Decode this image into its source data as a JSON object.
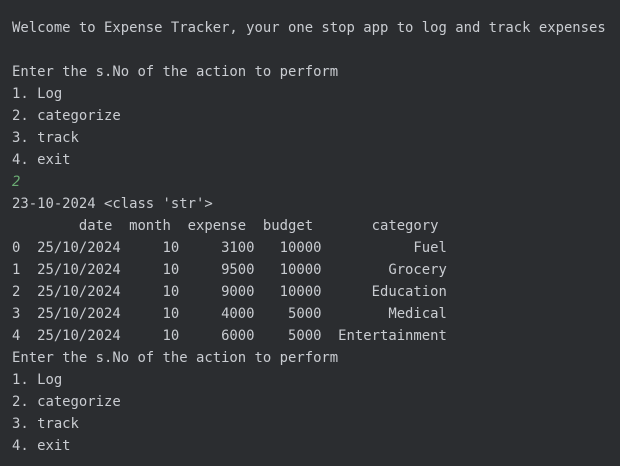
{
  "console": {
    "welcome": "Welcome to Expense Tracker, your one stop app to log and track expenses",
    "prompt": "Enter the s.No of the action to perform",
    "menu": [
      "1. Log",
      "2. categorize",
      "3. track",
      "4. exit"
    ],
    "user_input": "2",
    "date_debug": "23-10-2024 <class 'str'>",
    "table": {
      "header": "        date  month  expense  budget       category",
      "rows": [
        "0  25/10/2024     10     3100   10000           Fuel",
        "1  25/10/2024     10     9500   10000        Grocery",
        "2  25/10/2024     10     9000   10000      Education",
        "3  25/10/2024     10     4000    5000        Medical",
        "4  25/10/2024     10     6000    5000  Entertainment"
      ]
    },
    "prompt_again": "Enter the s.No of the action to perform",
    "menu_again": [
      "1. Log",
      "2. categorize",
      "3. track",
      "4. exit"
    ]
  },
  "colors": {
    "background": "#2b2d30",
    "text": "#c9ccd1",
    "user_input": "#6aab73"
  }
}
